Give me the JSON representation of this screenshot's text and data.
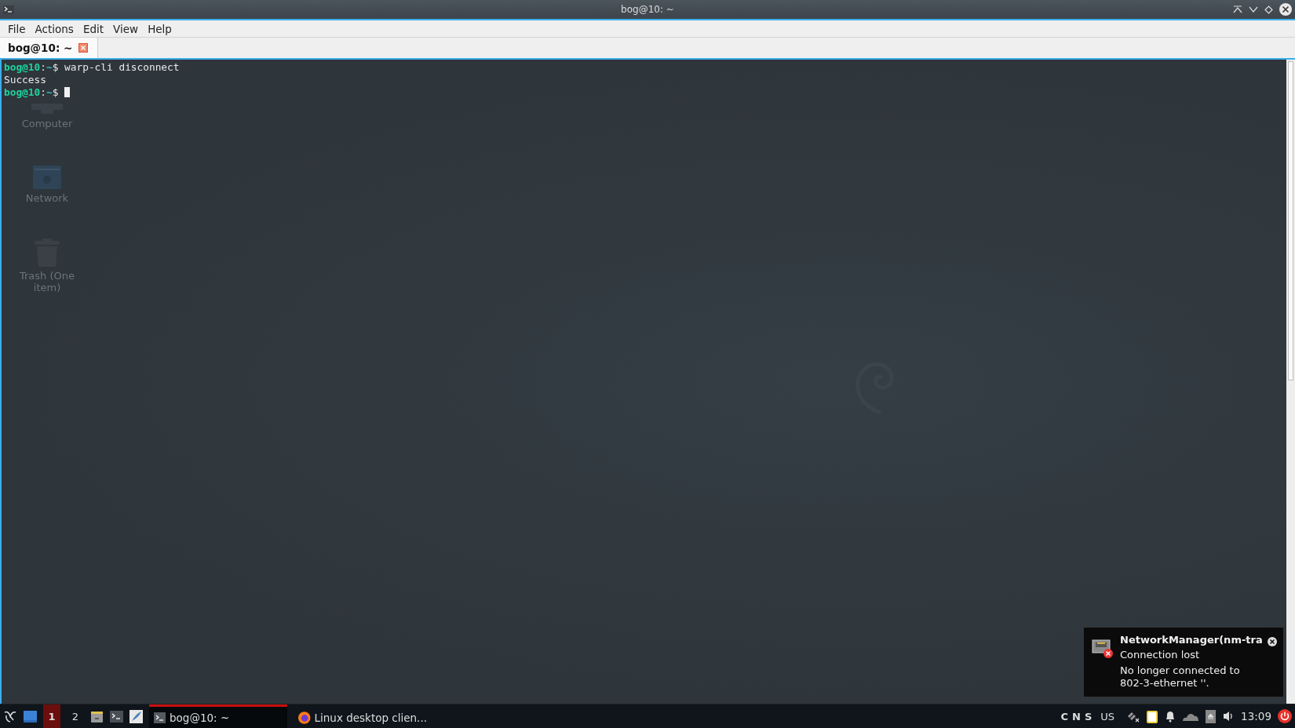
{
  "window": {
    "title": "bog@10: ~"
  },
  "menu": [
    "File",
    "Actions",
    "Edit",
    "View",
    "Help"
  ],
  "tabs": [
    {
      "label": "bog@10: ~",
      "selected": true
    }
  ],
  "terminal": {
    "lines": [
      {
        "kind": "prompt",
        "user": "bog@10",
        "separator": ":",
        "path": "~",
        "symbol": "$",
        "command": "warp-cli disconnect"
      },
      {
        "kind": "output",
        "text": "Success"
      },
      {
        "kind": "prompt",
        "user": "bog@10",
        "separator": ":",
        "path": "~",
        "symbol": "$",
        "cursor": true
      }
    ]
  },
  "desktop_icons": [
    {
      "kind": "computer",
      "label": "Computer"
    },
    {
      "kind": "network",
      "label": "Network"
    },
    {
      "kind": "trash",
      "label": "Trash (One item)"
    }
  ],
  "notification": {
    "title": "NetworkManager(nm-tra",
    "summary": "Connection lost",
    "body": "No longer connected to 802-3-ethernet ''."
  },
  "taskbar": {
    "workspaces": [
      {
        "label": "1",
        "selected": true
      },
      {
        "label": "2",
        "selected": false
      }
    ],
    "launchers": [
      {
        "kind": "files"
      },
      {
        "kind": "terminal"
      },
      {
        "kind": "editor"
      }
    ],
    "tasks": [
      {
        "kind": "terminal",
        "label": "bog@10: ~",
        "active": true
      },
      {
        "kind": "browser",
        "label": "Linux desktop clien...",
        "active": false
      }
    ],
    "lock_keys": [
      "C",
      "N",
      "S"
    ],
    "keyboard_layout": "US",
    "clock": "13:09"
  }
}
